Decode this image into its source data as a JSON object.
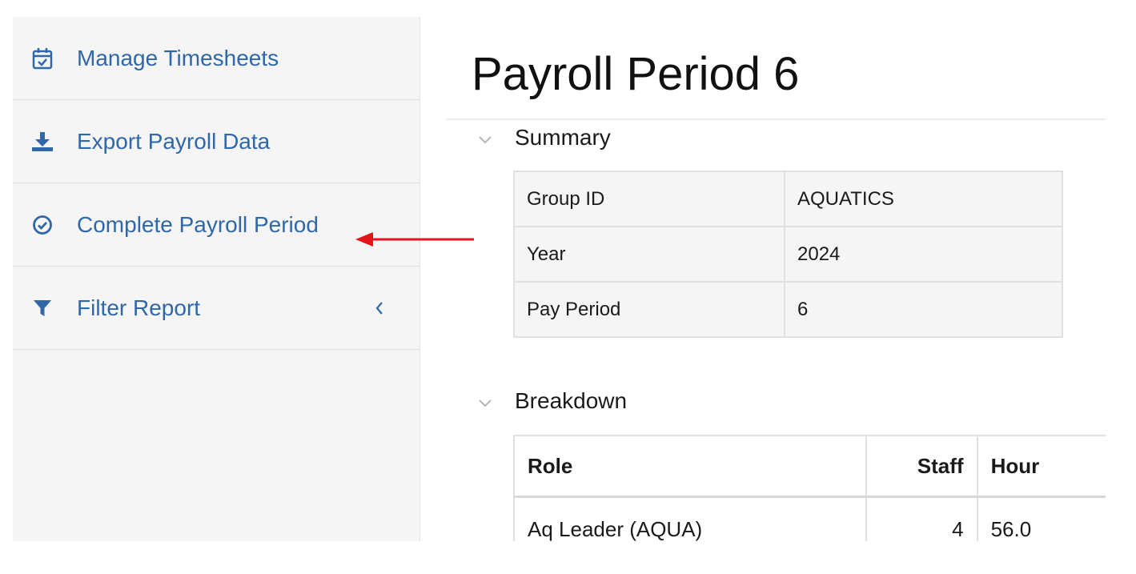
{
  "sidebar": {
    "items": [
      {
        "label": "Manage Timesheets",
        "icon": "calendar-check-icon"
      },
      {
        "label": "Export Payroll Data",
        "icon": "download-icon"
      },
      {
        "label": "Complete Payroll Period",
        "icon": "check-circle-icon"
      },
      {
        "label": "Filter Report",
        "icon": "filter-icon",
        "toggle_icon": "chevron-left-icon"
      }
    ]
  },
  "annotation": {
    "type": "arrow",
    "color": "#e0161b",
    "points_to": "Complete Payroll Period"
  },
  "main": {
    "title": "Payroll Period 6",
    "summary": {
      "heading": "Summary",
      "rows": [
        {
          "key": "Group ID",
          "value": "AQUATICS"
        },
        {
          "key": "Year",
          "value": "2024"
        },
        {
          "key": "Pay Period",
          "value": "6"
        }
      ]
    },
    "breakdown": {
      "heading": "Breakdown",
      "columns": [
        "Role",
        "Staff",
        "Hour"
      ],
      "rows": [
        {
          "role": "Aq Leader (AQUA)",
          "staff": "4",
          "hours": "56.0"
        }
      ]
    }
  },
  "colors": {
    "link": "#2f67a8",
    "sidebar_bg": "#f5f5f5",
    "arrow": "#e0161b"
  }
}
